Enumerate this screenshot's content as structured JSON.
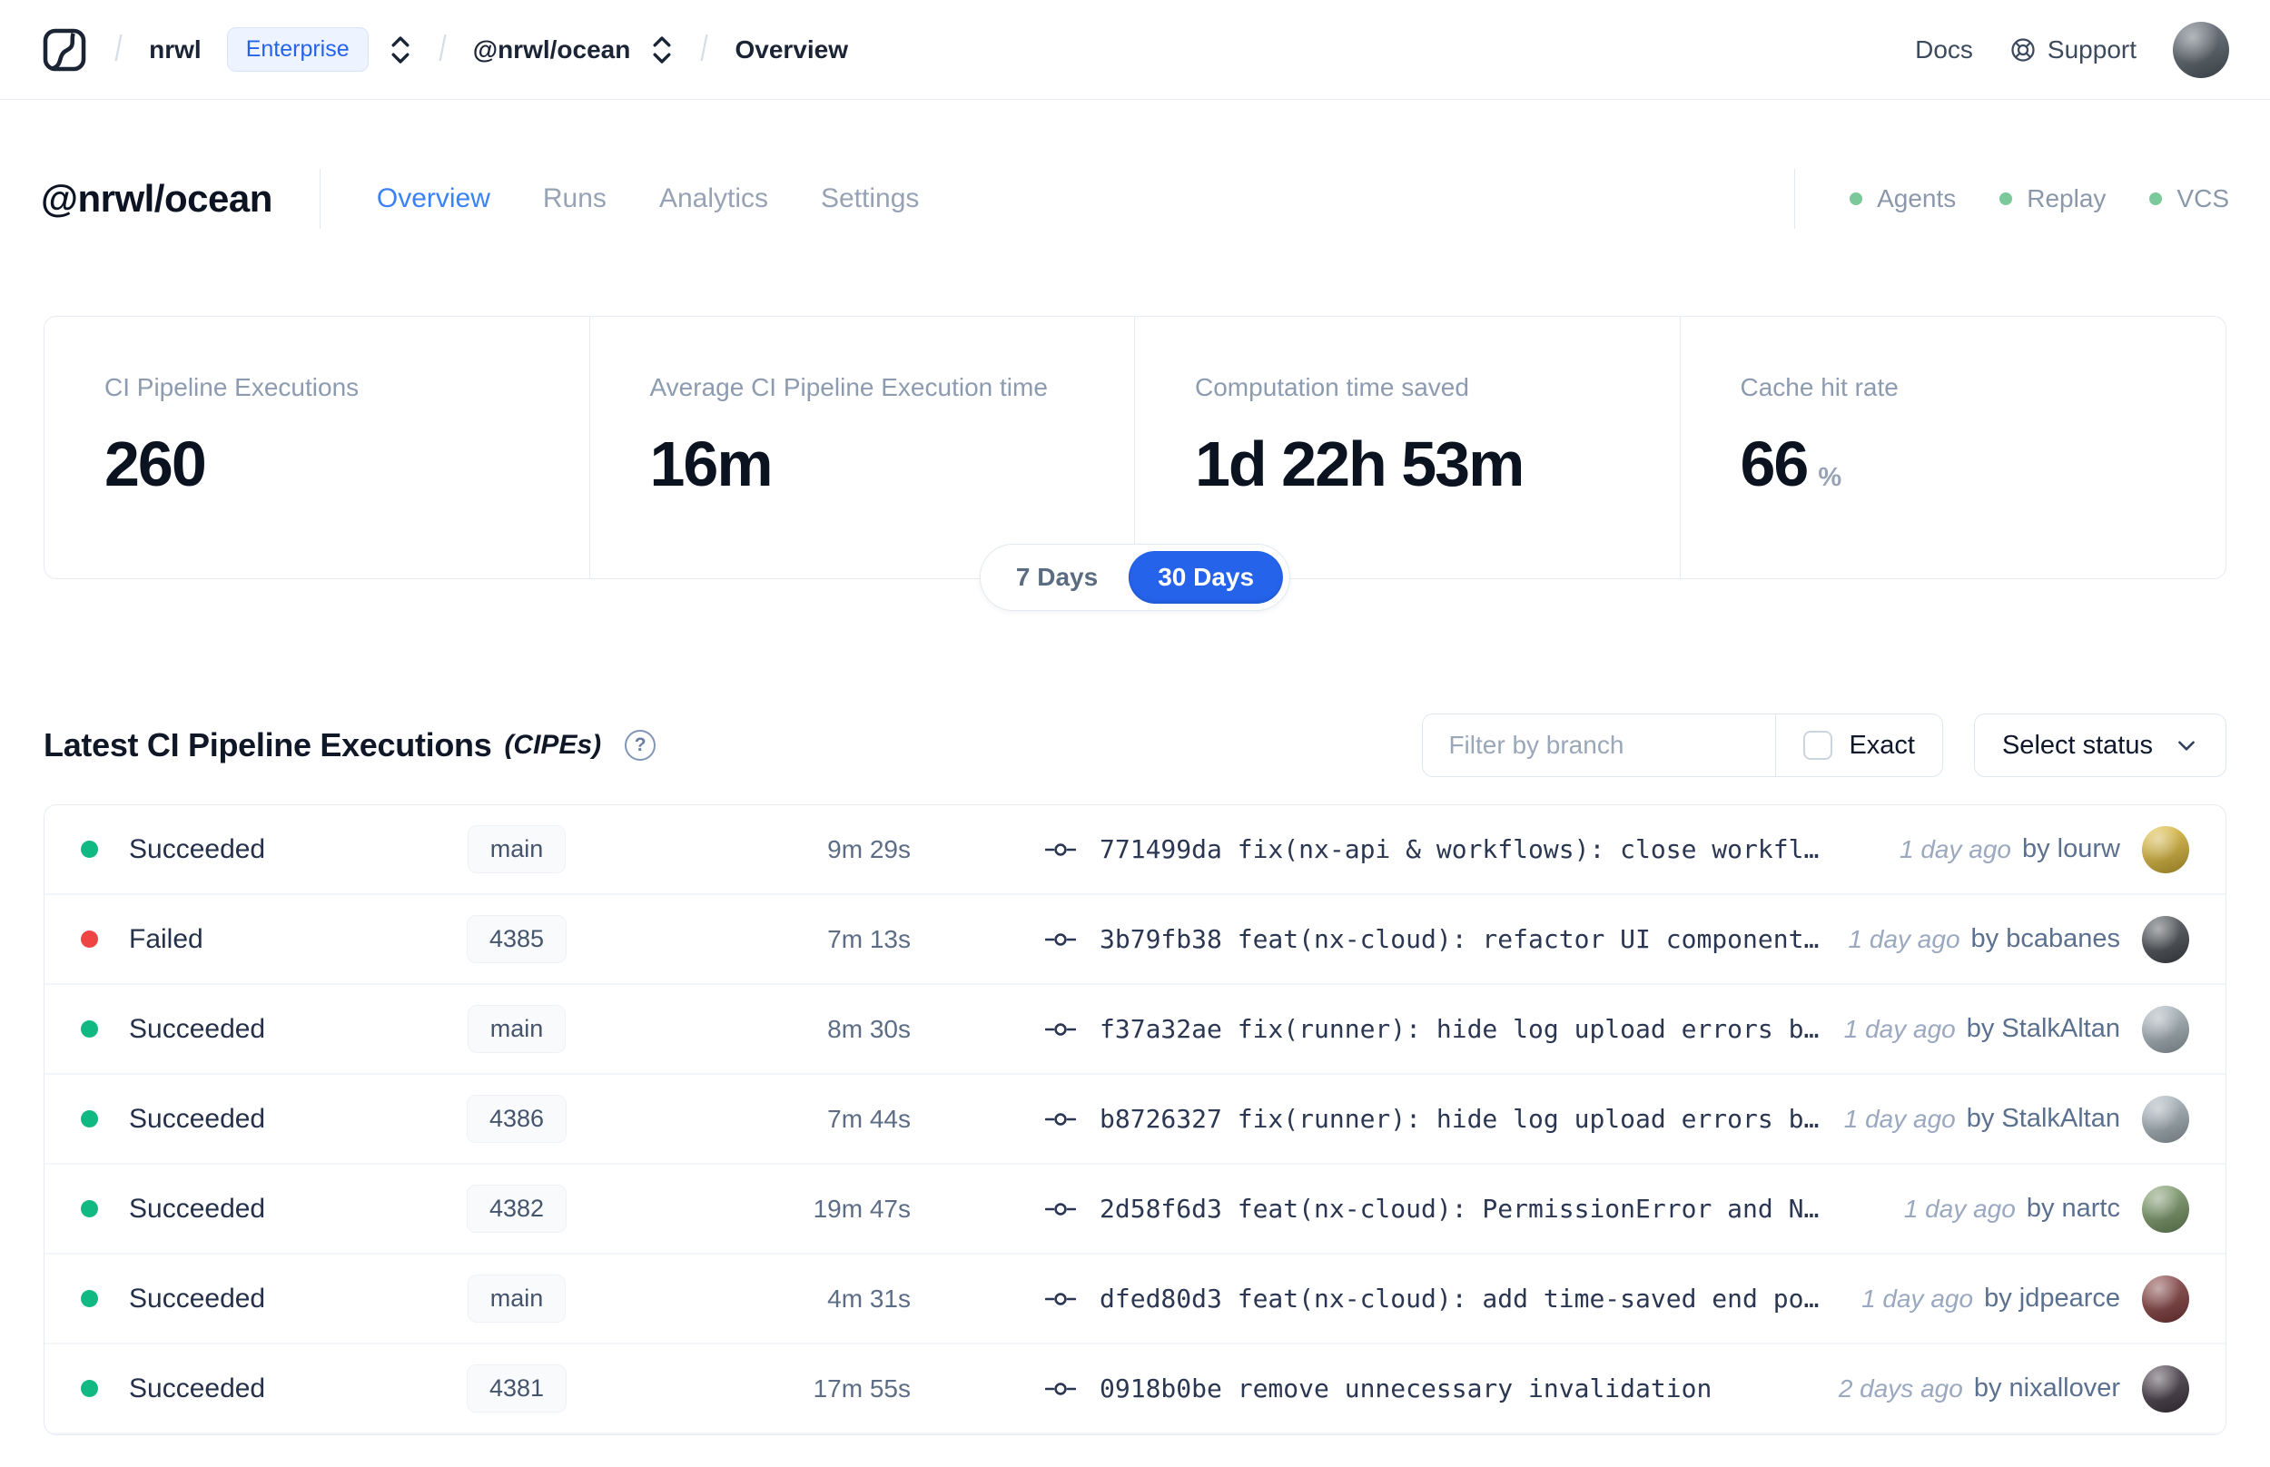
{
  "colors": {
    "accent_blue": "#2563eb",
    "tab_active_blue": "#3b82f6",
    "success_green": "#10b981",
    "failed_red": "#ef4444",
    "health_dot_green": "#7bc99a"
  },
  "topnav": {
    "breadcrumb": {
      "org": "nrwl",
      "org_badge": "Enterprise",
      "workspace": "@nrwl/ocean",
      "page": "Overview"
    },
    "docs_label": "Docs",
    "support_label": "Support",
    "avatar_color": "#5a646e"
  },
  "workspace_header": {
    "title": "@nrwl/ocean",
    "tabs": [
      {
        "label": "Overview"
      },
      {
        "label": "Runs"
      },
      {
        "label": "Analytics"
      },
      {
        "label": "Settings"
      }
    ],
    "statuses": [
      {
        "label": "Agents"
      },
      {
        "label": "Replay"
      },
      {
        "label": "VCS"
      }
    ]
  },
  "stats": {
    "cards": [
      {
        "label": "CI Pipeline Executions",
        "value": "260",
        "suffix": ""
      },
      {
        "label": "Average CI Pipeline Execution time",
        "value": "16m",
        "suffix": ""
      },
      {
        "label": "Computation time saved",
        "value": "1d 22h 53m",
        "suffix": ""
      },
      {
        "label": "Cache hit rate",
        "value": "66",
        "suffix": "%"
      }
    ],
    "range_toggle": {
      "option_7": "7 Days",
      "option_30": "30 Days",
      "selected": "30 Days"
    }
  },
  "cipes": {
    "title": "Latest CI Pipeline Executions",
    "title_suffix": "(CIPEs)",
    "help_glyph": "?",
    "filter": {
      "placeholder": "Filter by branch",
      "exact_label": "Exact",
      "status_label": "Select status"
    },
    "rows": [
      {
        "status": "Succeeded",
        "status_color": "#10b981",
        "branch": "main",
        "duration": "9m 29s",
        "commit": "771499da fix(nx-api & workflows): close workfl…",
        "time": "1 day ago",
        "author": "by lourw",
        "avatar_color": "#e8c23a"
      },
      {
        "status": "Failed",
        "status_color": "#ef4444",
        "branch": "4385",
        "duration": "7m 13s",
        "commit": "3b79fb38 feat(nx-cloud): refactor UI component…",
        "time": "1 day ago",
        "author": "by bcabanes",
        "avatar_color": "#4a4f55"
      },
      {
        "status": "Succeeded",
        "status_color": "#10b981",
        "branch": "main",
        "duration": "8m 30s",
        "commit": "f37a32ae fix(runner): hide log upload errors b…",
        "time": "1 day ago",
        "author": "by StalkAltan",
        "avatar_color": "#aebcc4"
      },
      {
        "status": "Succeeded",
        "status_color": "#10b981",
        "branch": "4386",
        "duration": "7m 44s",
        "commit": "b8726327 fix(runner): hide log upload errors b…",
        "time": "1 day ago",
        "author": "by StalkAltan",
        "avatar_color": "#aebcc4"
      },
      {
        "status": "Succeeded",
        "status_color": "#10b981",
        "branch": "4382",
        "duration": "19m 47s",
        "commit": "2d58f6d3 feat(nx-cloud): PermissionError and N…",
        "time": "1 day ago",
        "author": "by nartc",
        "avatar_color": "#7fa06b"
      },
      {
        "status": "Succeeded",
        "status_color": "#10b981",
        "branch": "main",
        "duration": "4m 31s",
        "commit": "dfed80d3 feat(nx-cloud): add time-saved end po…",
        "time": "1 day ago",
        "author": "by jdpearce",
        "avatar_color": "#8b4040"
      },
      {
        "status": "Succeeded",
        "status_color": "#10b981",
        "branch": "4381",
        "duration": "17m 55s",
        "commit": "0918b0be remove unnecessary invalidation",
        "time": "2 days ago",
        "author": "by nixallover",
        "avatar_color": "#463b47"
      }
    ]
  }
}
